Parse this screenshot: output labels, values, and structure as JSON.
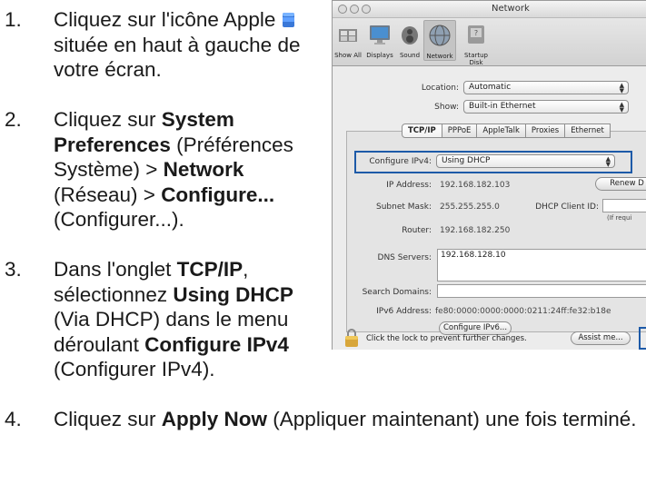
{
  "steps": [
    {
      "num": "1.",
      "parts": [
        {
          "t": "Cliquez sur l'icône Apple ",
          "b": false
        },
        {
          "t": " située en haut à gauche de votre écran.",
          "b": false
        }
      ]
    },
    {
      "num": "2.",
      "parts": [
        {
          "t": "Cliquez sur ",
          "b": false
        },
        {
          "t": "System Preferences",
          "b": true
        },
        {
          "t": " (Préférences Système) > ",
          "b": false
        },
        {
          "t": "Network",
          "b": true
        },
        {
          "t": " (Réseau) > ",
          "b": false
        },
        {
          "t": "Configure...",
          "b": true
        },
        {
          "t": " (Configurer...).",
          "b": false
        }
      ]
    },
    {
      "num": "3.",
      "parts": [
        {
          "t": "Dans l'onglet ",
          "b": false
        },
        {
          "t": "TCP/IP",
          "b": true
        },
        {
          "t": ", sélectionnez ",
          "b": false
        },
        {
          "t": "Using DHCP",
          "b": true
        },
        {
          "t": " (Via DHCP) dans le menu déroulant ",
          "b": false
        },
        {
          "t": "Configure IPv4",
          "b": true
        },
        {
          "t": " (Configurer IPv4).",
          "b": false
        }
      ]
    },
    {
      "num": "4.",
      "parts": [
        {
          "t": "Cliquez sur ",
          "b": false
        },
        {
          "t": "Apply Now",
          "b": true
        },
        {
          "t": " (Appliquer maintenant) une fois terminé.",
          "b": false
        }
      ]
    }
  ],
  "window": {
    "title": "Network",
    "toolbar": [
      {
        "label": "Show All",
        "icon": "show-all-icon"
      },
      {
        "label": "Displays",
        "icon": "displays-icon"
      },
      {
        "label": "Sound",
        "icon": "sound-icon"
      },
      {
        "label": "Network",
        "icon": "network-icon"
      },
      {
        "label": "Startup Disk",
        "icon": "startup-disk-icon"
      }
    ],
    "location_label": "Location:",
    "location_value": "Automatic",
    "show_label": "Show:",
    "show_value": "Built-in Ethernet",
    "tabs": [
      "TCP/IP",
      "PPPoE",
      "AppleTalk",
      "Proxies",
      "Ethernet"
    ],
    "configure_label": "Configure IPv4:",
    "configure_value": "Using DHCP",
    "ip_label": "IP Address:",
    "ip_value": "192.168.182.103",
    "renew_button": "Renew D",
    "subnet_label": "Subnet Mask:",
    "subnet_value": "255.255.255.0",
    "dhcp_client_label": "DHCP Client ID:",
    "if_required": "(If requi",
    "router_label": "Router:",
    "router_value": "192.168.182.250",
    "dns_label": "DNS Servers:",
    "dns_value": "192.168.128.10",
    "search_label": "Search Domains:",
    "ipv6_label": "IPv6 Address:",
    "ipv6_value": "fe80:0000:0000:0000:0211:24ff:fe32:b18e",
    "configure_ipv6_button": "Configure IPv6...",
    "lock_text": "Click the lock to prevent further changes.",
    "assist_button": "Assist me...",
    "highlight_color": "#1d5aa8",
    "apple_icon_color": "#3a78d8"
  }
}
